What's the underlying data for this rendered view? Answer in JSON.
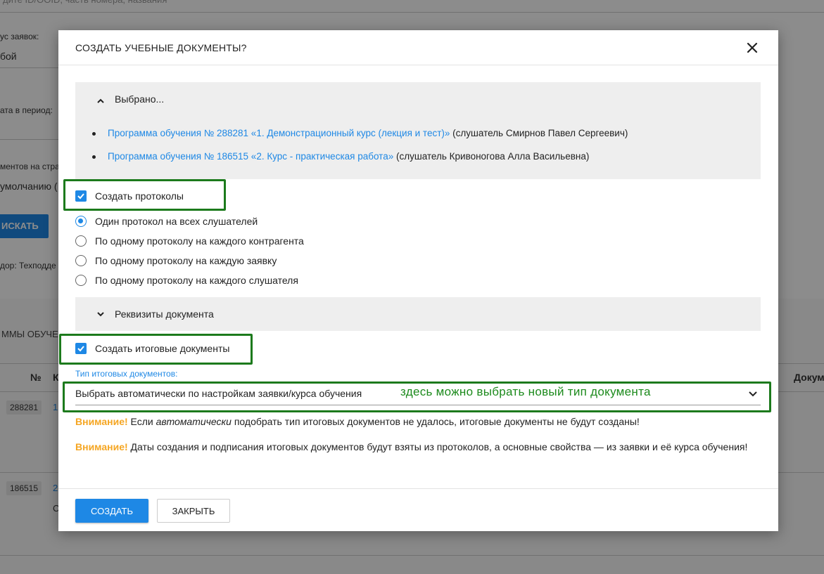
{
  "background": {
    "search_placeholder": "дите ID/ООID, часть номера, названия",
    "status_label": "ус заявок:",
    "status_value": "бой",
    "period_label": "ата в период:",
    "docs_label": "ментов на стра",
    "docs_value": "умолчанию (",
    "search_button": "ИСКАТЬ",
    "provider_text": "дор: Техподде",
    "section_title": "ММЫ ОБУЧЕН",
    "col_number": "№",
    "col_k": "К",
    "col_doc": "Докум",
    "rows": [
      {
        "id": "288281",
        "link": "1"
      },
      {
        "id": "186515",
        "link": "2",
        "extra": "С"
      }
    ]
  },
  "dialog": {
    "title": "СОЗДАТЬ УЧЕБНЫЕ ДОКУМЕНТЫ?",
    "selected_panel": {
      "heading": "Выбрано...",
      "items": [
        {
          "link": "Программа обучения № 288281 «1. Демонстрационный курс (лекция и тест)»",
          "note": " (слушатель Смирнов Павел Сергеевич)"
        },
        {
          "link": "Программа обучения № 186515 «2. Курс - практическая работа»",
          "note": " (слушатель Кривоногова Алла Васильевна)"
        }
      ]
    },
    "create_protocols": {
      "label": "Создать протоколы",
      "checked": true
    },
    "protocol_options": [
      {
        "label": "Один протокол на всех слушателей",
        "selected": true
      },
      {
        "label": "По одному протоколу на каждого контрагента",
        "selected": false
      },
      {
        "label": "По одному протоколу на каждую заявку",
        "selected": false
      },
      {
        "label": "По одному протоколу на каждого слушателя",
        "selected": false
      }
    ],
    "details_panel": {
      "heading": "Реквизиты документа"
    },
    "create_final_docs": {
      "label": "Создать итоговые документы",
      "checked": true
    },
    "final_doc_type": {
      "label": "Тип итоговых документов:",
      "value": "Выбрать автоматически по настройкам заявки/курса обучения",
      "annotation": "здесь можно выбрать новый тип документа"
    },
    "warnings": [
      {
        "prefix": "Внимание!",
        "part1": " Если ",
        "emph": "автоматически",
        "part2": " подобрать тип итоговых документов не удалось, итоговые документы не будут созданы!"
      },
      {
        "prefix": "Внимание!",
        "text": " Даты создания и подписания итоговых документов будут взяты из протоколов, а основные свойства — из заявки и её курса обучения!"
      }
    ],
    "buttons": {
      "create": "СОЗДАТЬ",
      "close": "ЗАКРЫТЬ"
    }
  },
  "colors": {
    "accent": "#1e88e5",
    "highlight": "#1c7a1c",
    "warning": "#f5a623",
    "overlay": "rgba(0,0,0,0.45)"
  },
  "icons": [
    "close-icon",
    "chevron-up-icon",
    "chevron-down-icon",
    "checkbox-checked-icon"
  ]
}
